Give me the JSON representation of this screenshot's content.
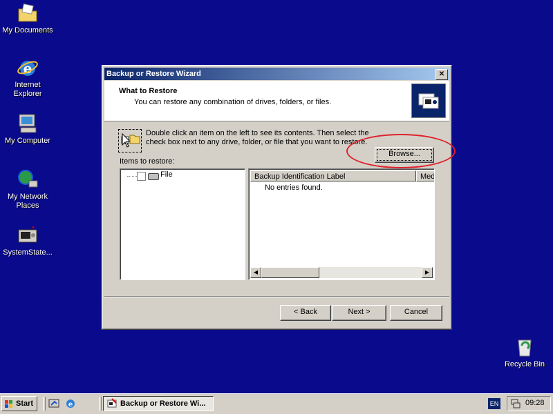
{
  "desktop": {
    "icons": [
      {
        "label": "My Documents"
      },
      {
        "label": "Internet Explorer"
      },
      {
        "label": "My Computer"
      },
      {
        "label": "My Network Places"
      },
      {
        "label": "SystemState..."
      },
      {
        "label": "Recycle Bin"
      }
    ]
  },
  "window": {
    "title": "Backup or Restore Wizard",
    "close_label": "✕",
    "header": {
      "title": "What to Restore",
      "subtitle": "You can restore any combination of drives, folders, or files."
    },
    "instruction": "Double click an item on the left to see its contents. Then select the check box next to any drive, folder, or file that you want to restore.",
    "browse_label": "Browse...",
    "items_label": "Items to restore:",
    "tree": {
      "items": [
        {
          "label": "File"
        }
      ]
    },
    "list": {
      "columns": [
        "Backup Identification Label",
        "Media"
      ],
      "empty_message": "No entries found."
    },
    "buttons": {
      "back": "< Back",
      "next": "Next >",
      "cancel": "Cancel"
    }
  },
  "taskbar": {
    "start_label": "Start",
    "task_label": "Backup or Restore Wi...",
    "language": "EN",
    "clock": "09:28"
  },
  "colors": {
    "desktop": "#0a0a8c",
    "titlebar_start": "#0a246a",
    "titlebar_end": "#a6caf0",
    "annotation": "#e0202a"
  }
}
